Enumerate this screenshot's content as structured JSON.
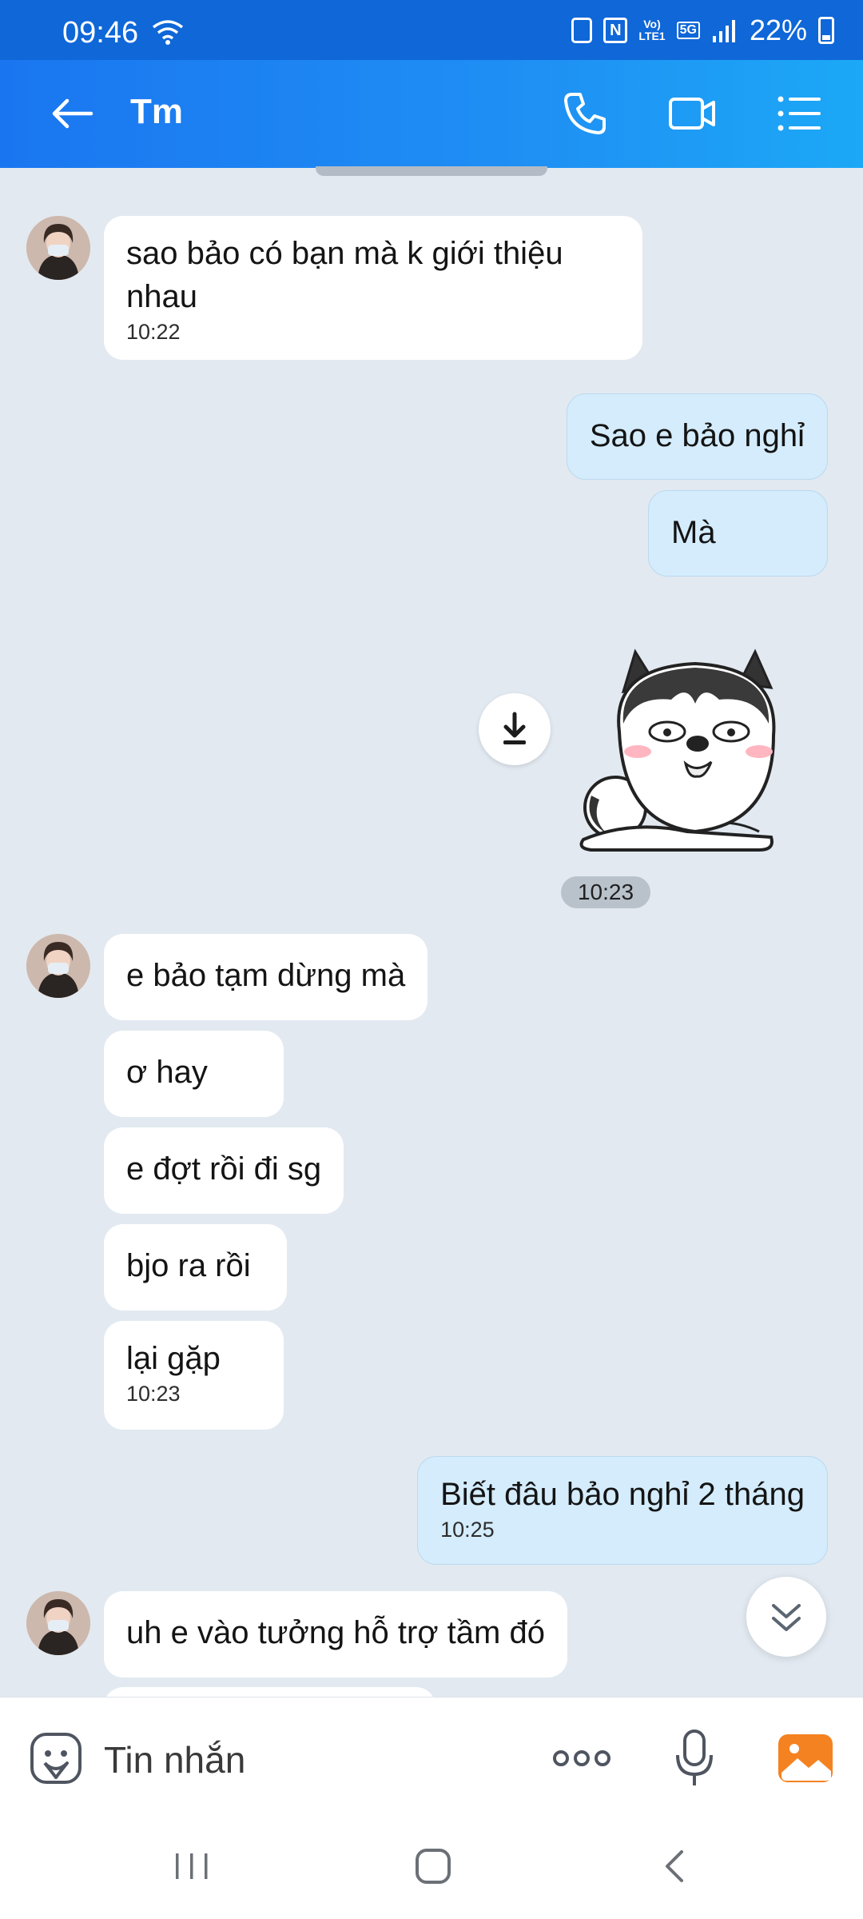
{
  "status": {
    "time": "09:46",
    "battery": "22%",
    "volte_top": "Vo)",
    "volte_bottom": "LTE1",
    "network": "5G"
  },
  "header": {
    "title": "Tm"
  },
  "messages": [
    {
      "dir": "in",
      "text": "sao bảo có bạn mà k giới thiệu nhau",
      "time": "10:22"
    },
    {
      "dir": "out",
      "text": "Sao e bảo nghỉ"
    },
    {
      "dir": "out",
      "text": "Mà"
    },
    {
      "dir": "out",
      "type": "sticker",
      "time": "10:23"
    },
    {
      "dir": "in",
      "text": "e bảo tạm dừng mà"
    },
    {
      "dir": "in",
      "text": "ơ hay"
    },
    {
      "dir": "in",
      "text": "e đợt rồi đi sg"
    },
    {
      "dir": "in",
      "text": "bjo ra rồi"
    },
    {
      "dir": "in",
      "text": "lại gặp",
      "time": "10:23"
    },
    {
      "dir": "out",
      "text": "Biết đâu bảo nghỉ 2 tháng",
      "time": "10:25"
    },
    {
      "dir": "in",
      "text": "uh e vào tưởng hỗ trợ tầm đó"
    }
  ],
  "composer": {
    "placeholder": "Tin nhắn"
  },
  "colors": {
    "header": "#1a76f0",
    "outgoing_bubble": "#d4ecfc",
    "incoming_bubble": "#ffffff",
    "chat_background": "#e2e9f1",
    "gallery_accent": "#f58220"
  },
  "icons": [
    "back-arrow-icon",
    "phone-icon",
    "video-call-icon",
    "menu-list-icon",
    "download-icon",
    "chevron-double-down-icon",
    "emoji-icon",
    "more-icon",
    "microphone-icon",
    "gallery-icon",
    "recent-apps-icon",
    "home-icon",
    "nav-back-icon"
  ]
}
